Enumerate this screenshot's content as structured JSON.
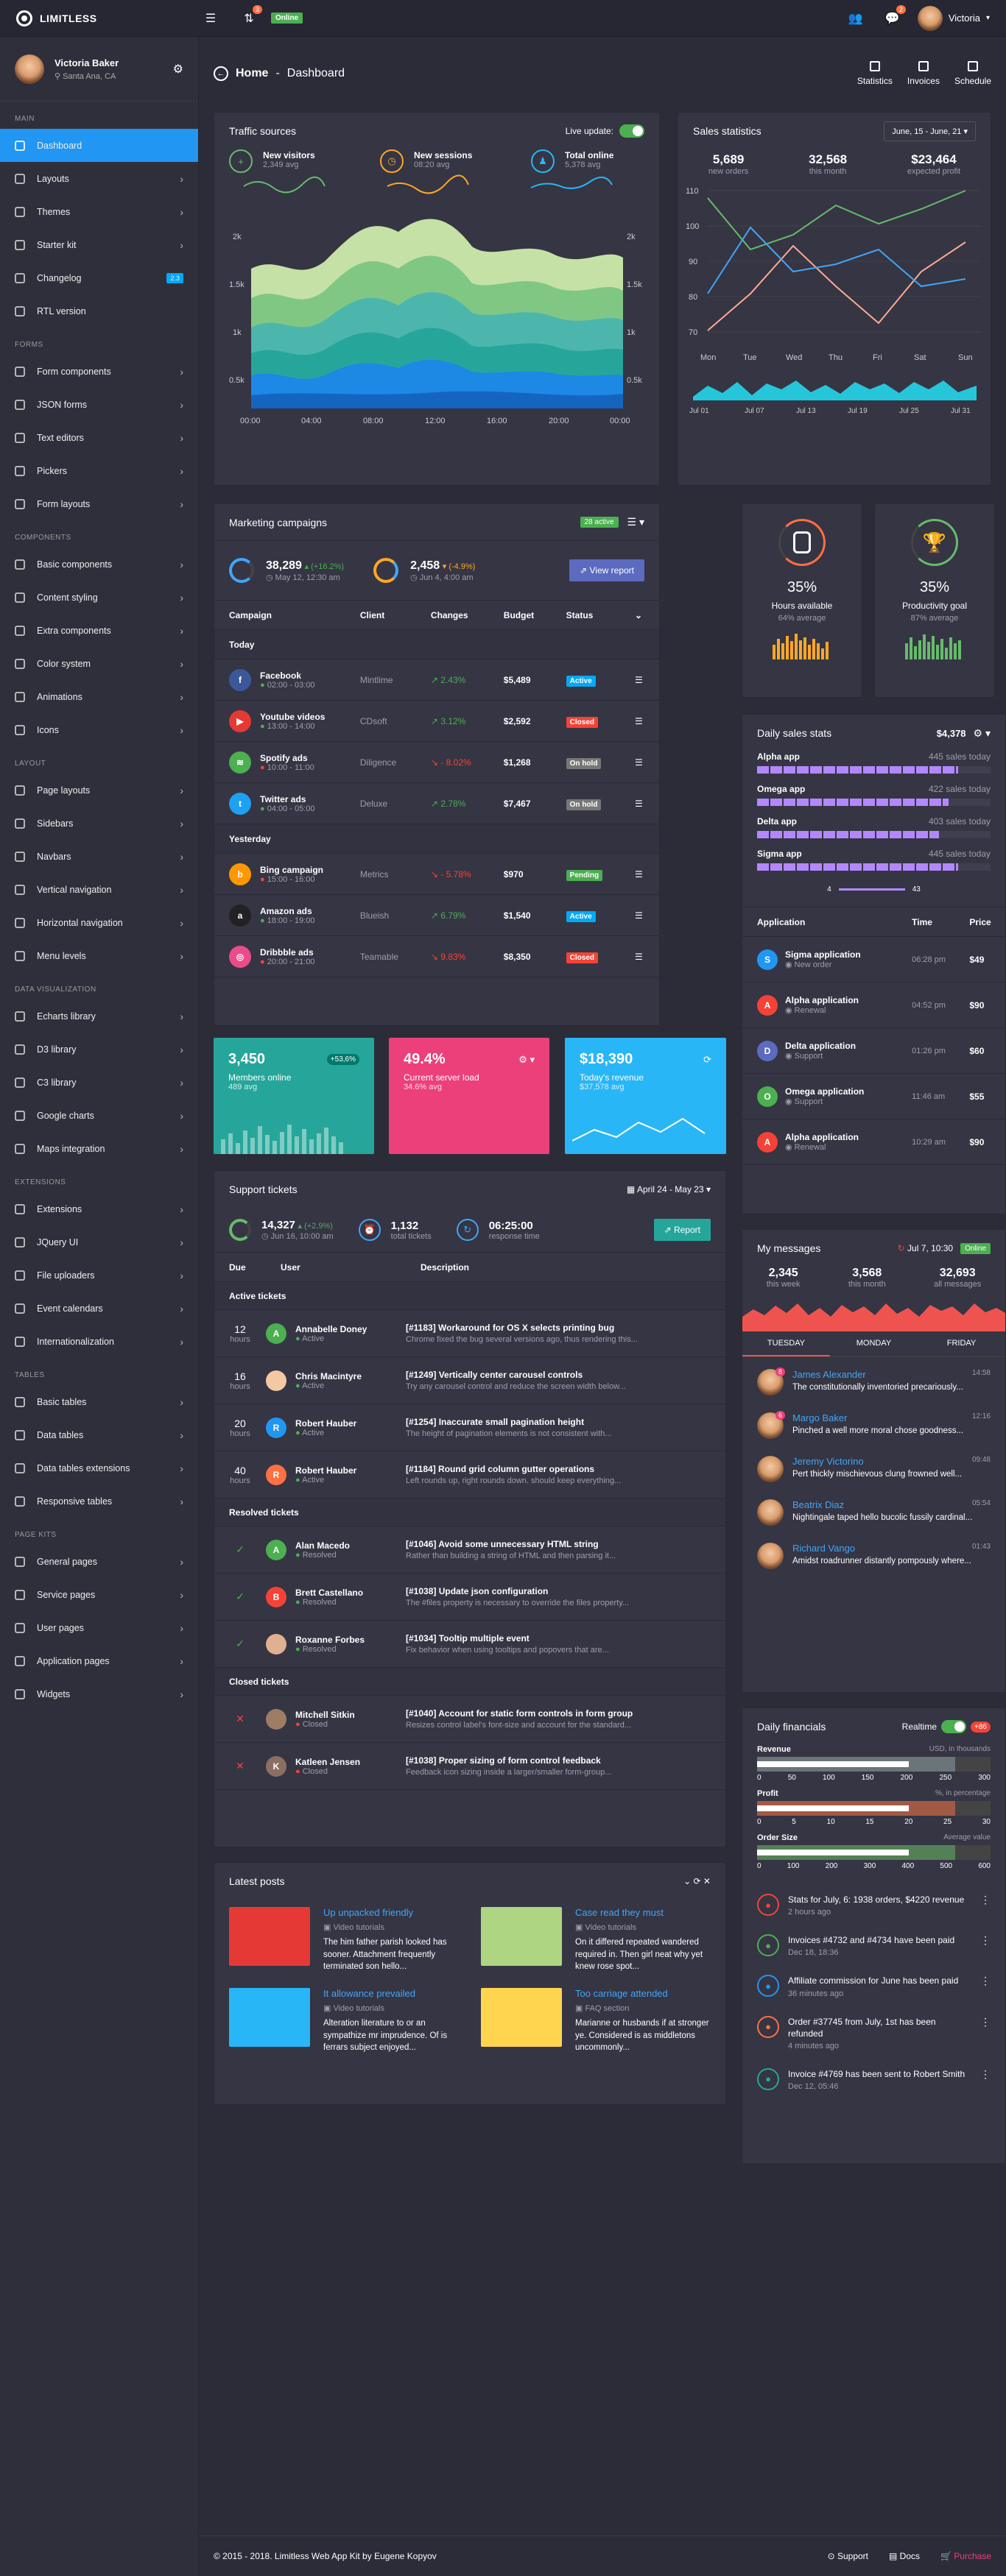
{
  "topbar": {
    "brand": "LIMITLESS",
    "notif_count": "3",
    "online": "Online",
    "msg_count": "2",
    "user": "Victoria"
  },
  "sidebar": {
    "user_name": "Victoria Baker",
    "user_loc": "Santa Ana, CA",
    "sections": [
      {
        "title": "MAIN",
        "items": [
          {
            "label": "Dashboard",
            "active": true
          },
          {
            "label": "Layouts",
            "chev": true
          },
          {
            "label": "Themes",
            "chev": true
          },
          {
            "label": "Starter kit",
            "chev": true
          },
          {
            "label": "Changelog",
            "badge": "2.3"
          },
          {
            "label": "RTL version"
          }
        ]
      },
      {
        "title": "FORMS",
        "items": [
          {
            "label": "Form components",
            "chev": true
          },
          {
            "label": "JSON forms",
            "chev": true
          },
          {
            "label": "Text editors",
            "chev": true
          },
          {
            "label": "Pickers",
            "chev": true
          },
          {
            "label": "Form layouts",
            "chev": true
          }
        ]
      },
      {
        "title": "COMPONENTS",
        "items": [
          {
            "label": "Basic components",
            "chev": true
          },
          {
            "label": "Content styling",
            "chev": true
          },
          {
            "label": "Extra components",
            "chev": true
          },
          {
            "label": "Color system",
            "chev": true
          },
          {
            "label": "Animations",
            "chev": true
          },
          {
            "label": "Icons",
            "chev": true
          }
        ]
      },
      {
        "title": "LAYOUT",
        "items": [
          {
            "label": "Page layouts",
            "chev": true
          },
          {
            "label": "Sidebars",
            "chev": true
          },
          {
            "label": "Navbars",
            "chev": true
          },
          {
            "label": "Vertical navigation",
            "chev": true
          },
          {
            "label": "Horizontal navigation",
            "chev": true
          },
          {
            "label": "Menu levels",
            "chev": true
          }
        ]
      },
      {
        "title": "DATA VISUALIZATION",
        "items": [
          {
            "label": "Echarts library",
            "chev": true
          },
          {
            "label": "D3 library",
            "chev": true
          },
          {
            "label": "C3 library",
            "chev": true
          },
          {
            "label": "Google charts",
            "chev": true
          },
          {
            "label": "Maps integration",
            "chev": true
          }
        ]
      },
      {
        "title": "EXTENSIONS",
        "items": [
          {
            "label": "Extensions",
            "chev": true
          },
          {
            "label": "JQuery UI",
            "chev": true
          },
          {
            "label": "File uploaders",
            "chev": true
          },
          {
            "label": "Event calendars",
            "chev": true
          },
          {
            "label": "Internationalization",
            "chev": true
          }
        ]
      },
      {
        "title": "TABLES",
        "items": [
          {
            "label": "Basic tables",
            "chev": true
          },
          {
            "label": "Data tables",
            "chev": true
          },
          {
            "label": "Data tables extensions",
            "chev": true
          },
          {
            "label": "Responsive tables",
            "chev": true
          }
        ]
      },
      {
        "title": "PAGE KITS",
        "items": [
          {
            "label": "General pages",
            "chev": true
          },
          {
            "label": "Service pages",
            "chev": true
          },
          {
            "label": "User pages",
            "chev": true
          },
          {
            "label": "Application pages",
            "chev": true
          },
          {
            "label": "Widgets",
            "chev": true
          }
        ]
      }
    ]
  },
  "header": {
    "home": "Home",
    "title": "Dashboard",
    "actions": [
      "Statistics",
      "Invoices",
      "Schedule"
    ]
  },
  "traffic": {
    "title": "Traffic sources",
    "live_label": "Live update:",
    "stats": [
      {
        "label": "New visitors",
        "value": "2,349 avg"
      },
      {
        "label": "New sessions",
        "value": "08:20 avg"
      },
      {
        "label": "Total online",
        "value": "5,378 avg"
      }
    ],
    "yticks": [
      "2k",
      "1.5k",
      "1k",
      "0.5k"
    ],
    "xticks": [
      "00:00",
      "04:00",
      "08:00",
      "12:00",
      "16:00",
      "20:00",
      "00:00"
    ]
  },
  "sales": {
    "title": "Sales statistics",
    "range": "June, 15 - June, 21",
    "stats": [
      {
        "value": "5,689",
        "label": "new orders"
      },
      {
        "value": "32,568",
        "label": "this month"
      },
      {
        "value": "$23,464",
        "label": "expected profit"
      }
    ],
    "yticks": [
      "110",
      "100",
      "90",
      "80",
      "70"
    ],
    "days": [
      "Mon",
      "Tue",
      "Wed",
      "Thu",
      "Fri",
      "Sat",
      "Sun"
    ],
    "months": [
      "Jul 01",
      "Jul 07",
      "Jul 13",
      "Jul 19",
      "Jul 25",
      "Jul 31"
    ]
  },
  "campaigns": {
    "title": "Marketing campaigns",
    "badge": "28 active",
    "stat1": {
      "value": "38,289",
      "change": "(+16.2%)",
      "date": "May 12, 12:30 am"
    },
    "stat2": {
      "value": "2,458",
      "change": "(-4.9%)",
      "date": "Jun 4, 4:00 am"
    },
    "report": "View report",
    "cols": [
      "Campaign",
      "Client",
      "Changes",
      "Budget",
      "Status"
    ],
    "groups": [
      {
        "label": "Today",
        "rows": [
          {
            "name": "Facebook",
            "time": "02:00 - 03:00",
            "client": "Mintlime",
            "change": "2.43%",
            "up": true,
            "budget": "$5,489",
            "status": "Active",
            "cls": "active",
            "color": "#3b5998",
            "letter": "f"
          },
          {
            "name": "Youtube videos",
            "time": "13:00 - 14:00",
            "client": "CDsoft",
            "change": "3.12%",
            "up": true,
            "budget": "$2,592",
            "status": "Closed",
            "cls": "closed",
            "color": "#e53935",
            "letter": "▶"
          },
          {
            "name": "Spotify ads",
            "time": "10:00 - 11:00",
            "client": "Diligence",
            "change": "- 8.02%",
            "up": false,
            "budget": "$1,268",
            "status": "On hold",
            "cls": "onhold",
            "color": "#4caf50",
            "letter": "≋"
          },
          {
            "name": "Twitter ads",
            "time": "04:00 - 05:00",
            "client": "Deluxe",
            "change": "2.78%",
            "up": true,
            "budget": "$7,467",
            "status": "On hold",
            "cls": "onhold",
            "color": "#1da1f2",
            "letter": "t"
          }
        ]
      },
      {
        "label": "Yesterday",
        "rows": [
          {
            "name": "Bing campaign",
            "time": "15:00 - 16:00",
            "client": "Metrics",
            "change": "- 5.78%",
            "up": false,
            "budget": "$970",
            "status": "Pending",
            "cls": "pending",
            "color": "#ff9800",
            "letter": "b"
          },
          {
            "name": "Amazon ads",
            "time": "18:00 - 19:00",
            "client": "Blueish",
            "change": "6.79%",
            "up": true,
            "budget": "$1,540",
            "status": "Active",
            "cls": "active",
            "color": "#222",
            "letter": "a"
          },
          {
            "name": "Dribbble ads",
            "time": "20:00 - 21:00",
            "client": "Teamable",
            "change": "9.83%",
            "up": false,
            "budget": "$8,350",
            "status": "Closed",
            "cls": "closed",
            "color": "#ea4c89",
            "letter": "◎"
          }
        ]
      }
    ]
  },
  "gauges": [
    {
      "value": "35%",
      "label": "Hours available",
      "sub": "64% average"
    },
    {
      "value": "35%",
      "label": "Productivity goal",
      "sub": "87% average"
    }
  ],
  "daily_sales": {
    "title": "Daily sales stats",
    "total": "$4,378",
    "bars": [
      {
        "name": "Alpha app",
        "value": "445 sales today",
        "fill": 0.86
      },
      {
        "name": "Omega app",
        "value": "422 sales today",
        "fill": 0.82
      },
      {
        "name": "Delta app",
        "value": "403 sales today",
        "fill": 0.78
      },
      {
        "name": "Sigma app",
        "value": "445 sales today",
        "fill": 0.86
      }
    ],
    "slider_min": "4",
    "slider_max": "43",
    "cols": [
      "Application",
      "Time",
      "Price"
    ],
    "rows": [
      {
        "letter": "S",
        "color": "#2196f3",
        "name": "Sigma application",
        "sub": "New order",
        "time": "06:28 pm",
        "price": "$49"
      },
      {
        "letter": "A",
        "color": "#f44336",
        "name": "Alpha application",
        "sub": "Renewal",
        "time": "04:52 pm",
        "price": "$90"
      },
      {
        "letter": "D",
        "color": "#5c6bc0",
        "name": "Delta application",
        "sub": "Support",
        "time": "01:26 pm",
        "price": "$60"
      },
      {
        "letter": "O",
        "color": "#4caf50",
        "name": "Omega application",
        "sub": "Support",
        "time": "11:46 am",
        "price": "$55"
      },
      {
        "letter": "A",
        "color": "#f44336",
        "name": "Alpha application",
        "sub": "Renewal",
        "time": "10:29 am",
        "price": "$90"
      }
    ]
  },
  "stat_cards": [
    {
      "value": "3,450",
      "label": "Members online",
      "sub": "489 avg",
      "badge": "+53,6%",
      "color": "#26a69a"
    },
    {
      "value": "49.4%",
      "label": "Current server load",
      "sub": "34.6% avg",
      "color": "#ec407a"
    },
    {
      "value": "$18,390",
      "label": "Today's revenue",
      "sub": "$37,578 avg",
      "color": "#29b6f6"
    }
  ],
  "tickets": {
    "title": "Support tickets",
    "range": "April 24 - May 23",
    "stat1": {
      "value": "14,327",
      "change": "(+2.9%)",
      "date": "Jun 16, 10:00 am"
    },
    "stat2": {
      "value": "1,132",
      "label": "total tickets"
    },
    "stat3": {
      "value": "06:25:00",
      "label": "response time"
    },
    "report": "Report",
    "cols": [
      "Due",
      "User",
      "Description"
    ],
    "groups": [
      {
        "label": "Active tickets",
        "rows": [
          {
            "due": "12",
            "unit": "hours",
            "letter": "A",
            "color": "#4caf50",
            "user": "Annabelle Doney",
            "status": "Active",
            "title": "[#1183] Workaround for OS X selects printing bug",
            "desc": "Chrome fixed the bug several versions ago, thus rendering this..."
          },
          {
            "due": "16",
            "unit": "hours",
            "letter": "",
            "color": "#f3c9a4",
            "user": "Chris Macintyre",
            "status": "Active",
            "title": "[#1249] Vertically center carousel controls",
            "desc": "Try any carousel control and reduce the screen width below..."
          },
          {
            "due": "20",
            "unit": "hours",
            "letter": "R",
            "color": "#2196f3",
            "user": "Robert Hauber",
            "status": "Active",
            "title": "[#1254] Inaccurate small pagination height",
            "desc": "The height of pagination elements is not consistent with..."
          },
          {
            "due": "40",
            "unit": "hours",
            "letter": "R",
            "color": "#ff7043",
            "user": "Robert Hauber",
            "status": "Active",
            "title": "[#1184] Round grid column gutter operations",
            "desc": "Left rounds up, right rounds down. should keep everything..."
          }
        ]
      },
      {
        "label": "Resolved tickets",
        "rows": [
          {
            "due": "✓",
            "unit": "",
            "letter": "A",
            "color": "#4caf50",
            "user": "Alan Macedo",
            "status": "Resolved",
            "title": "[#1046] Avoid some unnecessary HTML string",
            "desc": "Rather than building a string of HTML and then parsing it..."
          },
          {
            "due": "✓",
            "unit": "",
            "letter": "B",
            "color": "#f44336",
            "user": "Brett Castellano",
            "status": "Resolved",
            "title": "[#1038] Update json configuration",
            "desc": "The  #files  property is necessary to override the files property..."
          },
          {
            "due": "✓",
            "unit": "",
            "letter": "",
            "color": "#e0b090",
            "user": "Roxanne Forbes",
            "status": "Resolved",
            "title": "[#1034] Tooltip multiple event",
            "desc": "Fix behavior when using tooltips and popovers that are..."
          }
        ]
      },
      {
        "label": "Closed tickets",
        "rows": [
          {
            "due": "✕",
            "unit": "",
            "letter": "",
            "color": "#9e7d65",
            "user": "Mitchell Sitkin",
            "status": "Closed",
            "title": "[#1040] Account for static form controls in form group",
            "desc": "Resizes control label's font-size and account for the standard..."
          },
          {
            "due": "✕",
            "unit": "",
            "letter": "K",
            "color": "#8d6e63",
            "user": "Katleen Jensen",
            "status": "Closed",
            "title": "[#1038] Proper sizing of form control feedback",
            "desc": "Feedback icon sizing inside a larger/smaller form-group..."
          }
        ]
      }
    ]
  },
  "posts": {
    "title": "Latest posts",
    "items": [
      {
        "title": "Up unpacked friendly",
        "cat": "Video tutorials",
        "text": "The him father parish looked has sooner. Attachment frequently terminated son hello...",
        "color": "#e53935"
      },
      {
        "title": "Case read they must",
        "cat": "Video tutorials",
        "text": "On it differed repeated wandered required in. Then girl neat why yet knew rose spot...",
        "color": "#aed581"
      },
      {
        "title": "It allowance prevailed",
        "cat": "Video tutorials",
        "text": "Alteration literature to or an sympathize mr imprudence. Of is ferrars subject enjoyed...",
        "color": "#29b6f6"
      },
      {
        "title": "Too carriage attended",
        "cat": "FAQ section",
        "text": "Marianne or husbands if at stronger ye. Considered is as middletons uncommonly...",
        "color": "#ffd54f"
      }
    ]
  },
  "messages": {
    "title": "My messages",
    "date": "Jul 7, 10:30",
    "online": "Online",
    "stats": [
      {
        "value": "2,345",
        "label": "this week"
      },
      {
        "value": "3,568",
        "label": "this month"
      },
      {
        "value": "32,693",
        "label": "all messages"
      }
    ],
    "tabs": [
      "TUESDAY",
      "MONDAY",
      "FRIDAY"
    ],
    "items": [
      {
        "name": "James Alexander",
        "time": "14:58",
        "text": "The constitutionally inventoried precariously...",
        "badge": "8"
      },
      {
        "name": "Margo Baker",
        "time": "12:16",
        "text": "Pinched a well more moral chose goodness...",
        "badge": "6"
      },
      {
        "name": "Jeremy Victorino",
        "time": "09:48",
        "text": "Pert thickly mischievous clung frowned well...",
        "badge": ""
      },
      {
        "name": "Beatrix Diaz",
        "time": "05:54",
        "text": "Nightingale taped hello bucolic fussily cardinal...",
        "badge": ""
      },
      {
        "name": "Richard Vango",
        "time": "01:43",
        "text": "Amidst roadrunner distantly pompously where...",
        "badge": ""
      }
    ]
  },
  "financials": {
    "title": "Daily financials",
    "realtime": "Realtime",
    "count": "+86",
    "bullets": [
      {
        "label": "Revenue",
        "unit": "USD, in thousands",
        "ticks": [
          "0",
          "50",
          "100",
          "150",
          "200",
          "250",
          "300"
        ],
        "color": "#90a4ae"
      },
      {
        "label": "Profit",
        "unit": "%, in percentage",
        "ticks": [
          "0",
          "5",
          "10",
          "15",
          "20",
          "25",
          "30"
        ],
        "color": "#ff7043"
      },
      {
        "label": "Order Size",
        "unit": "Average value",
        "ticks": [
          "0",
          "100",
          "200",
          "300",
          "400",
          "500",
          "600"
        ],
        "color": "#66bb6a"
      }
    ],
    "feed": [
      {
        "text": "Stats for July, 6: 1938 orders, $4220 revenue",
        "time": "2 hours ago",
        "color": "#f44336"
      },
      {
        "text": "Invoices #4732 and #4734 have been paid",
        "time": "Dec 18, 18:36",
        "color": "#4caf50"
      },
      {
        "text": "Affiliate commission for June has been paid",
        "time": "36 minutes ago",
        "color": "#2196f3"
      },
      {
        "text": "Order #37745 from July, 1st has been refunded",
        "time": "4 minutes ago",
        "color": "#ff7043"
      },
      {
        "text": "Invoice #4769 has been sent to Robert Smith",
        "time": "Dec 12, 05:46",
        "color": "#26a69a"
      }
    ]
  },
  "footer": {
    "copyright": "© 2015 - 2018. Limitless Web App Kit by Eugene Kopyov",
    "links": [
      "Support",
      "Docs",
      "Purchase"
    ]
  }
}
